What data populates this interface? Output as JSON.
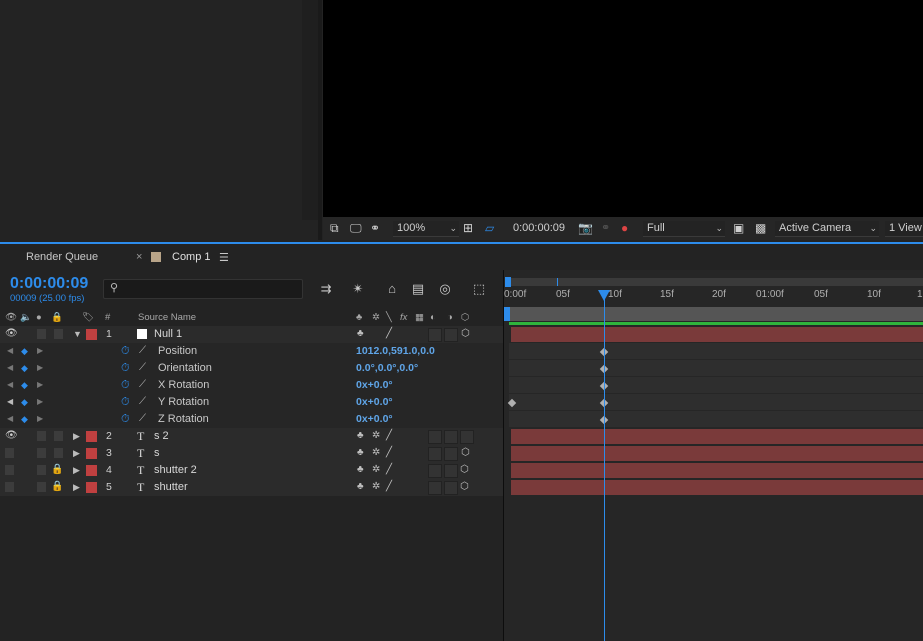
{
  "viewer": {
    "zoom": "100%",
    "timecode": "0:00:00:09",
    "resolution": "Full",
    "camera": "Active Camera",
    "views": "1 View"
  },
  "tabs": {
    "render_queue": "Render Queue",
    "comp": "Comp 1",
    "close_glyph": "×",
    "menu_glyph": "☰"
  },
  "timeline": {
    "timecode": "0:00:00:09",
    "frame_info": "00009 (25.00 fps)",
    "search_placeholder": "",
    "headers": {
      "number": "#",
      "source_name": "Source Name"
    },
    "ruler_ticks": [
      "0:00f",
      "05f",
      "10f",
      "15f",
      "20f",
      "01:00f",
      "05f",
      "10f",
      "1"
    ]
  },
  "layers": [
    {
      "num": "1",
      "name": "Null 1",
      "type": "null",
      "expanded": true,
      "color": "#c04040"
    },
    {
      "num": "2",
      "name": "s 2",
      "type": "T",
      "expanded": false,
      "color": "#c04040"
    },
    {
      "num": "3",
      "name": "s",
      "type": "T",
      "expanded": false,
      "color": "#c04040"
    },
    {
      "num": "4",
      "name": "shutter 2",
      "type": "T",
      "expanded": false,
      "color": "#c04040"
    },
    {
      "num": "5",
      "name": "shutter",
      "type": "T",
      "expanded": false,
      "color": "#c04040"
    }
  ],
  "properties": [
    {
      "name": "Position",
      "value": "1012.0,591.0,0.0"
    },
    {
      "name": "Orientation",
      "value": "0.0°,0.0°,0.0°"
    },
    {
      "name": "X Rotation",
      "value": "0x+0.0°"
    },
    {
      "name": "Y Rotation",
      "value": "0x+0.0°"
    },
    {
      "name": "Z Rotation",
      "value": "0x+0.0°"
    }
  ],
  "colors": {
    "accent": "#2d8ceb",
    "layer_bar": "#7a3a3a",
    "label_red": "#c04040",
    "work_area_green": "#2fb43c"
  }
}
